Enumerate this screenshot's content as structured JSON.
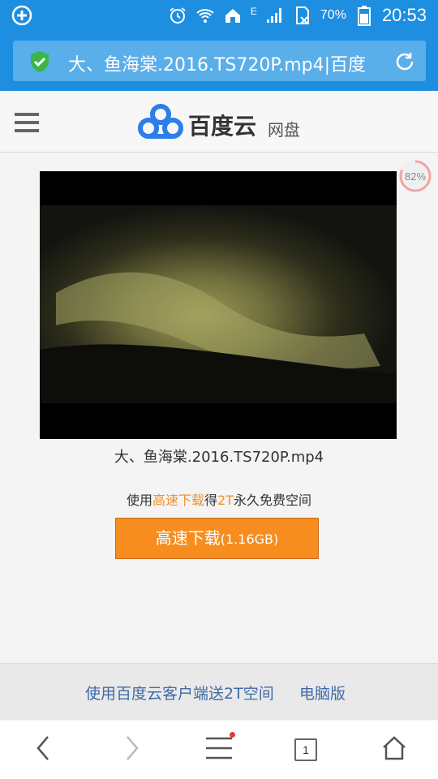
{
  "status_bar": {
    "battery_percent": "70%",
    "time": "20:53",
    "network_label": "E"
  },
  "url_bar": {
    "title": "大、鱼海棠.2016.TS720P.mp4|百度"
  },
  "header": {
    "brand": "百度云",
    "sub": "网盘"
  },
  "main": {
    "progress_badge": "82%",
    "file_name": "大、鱼海棠.2016.TS720P.mp4",
    "promo": {
      "prefix": "使用",
      "highlight1": "高速下载",
      "mid": "得",
      "highlight2": "2T",
      "suffix": "永久免费空间"
    },
    "download_button": {
      "label": "高速下载",
      "size": "(1.16GB)"
    }
  },
  "footer": {
    "client_link": "使用百度云客户端送2T空间",
    "desktop_link": "电脑版"
  },
  "toolbar": {
    "tab_count": "1"
  },
  "colors": {
    "status_blue": "#1e8ee0",
    "accent_orange": "#f78d1e",
    "link_blue": "#3f6aa6"
  }
}
